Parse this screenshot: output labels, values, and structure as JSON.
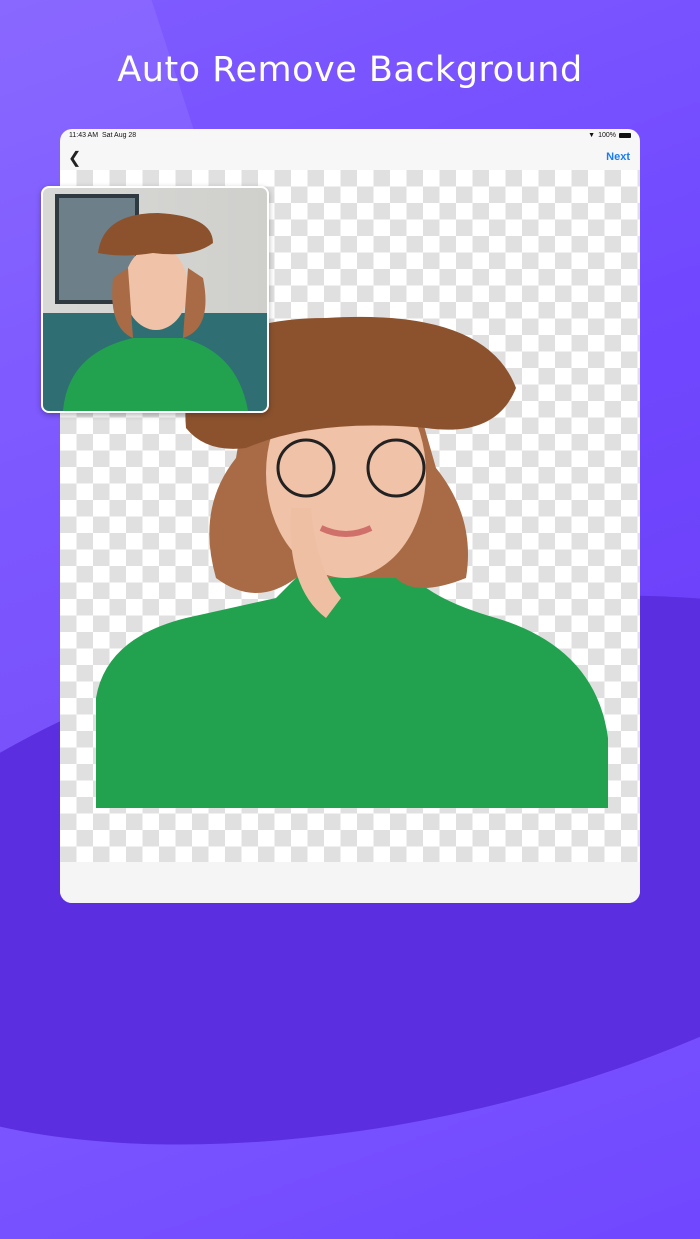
{
  "headline": "Auto Remove Background",
  "status_bar": {
    "time": "11:43 AM",
    "date": "Sat Aug 28",
    "battery": "100%"
  },
  "nav": {
    "back_icon": "chevron-left-icon",
    "next_label": "Next"
  },
  "colors": {
    "accent": "#1a7cf5",
    "background": "#7148ff"
  }
}
